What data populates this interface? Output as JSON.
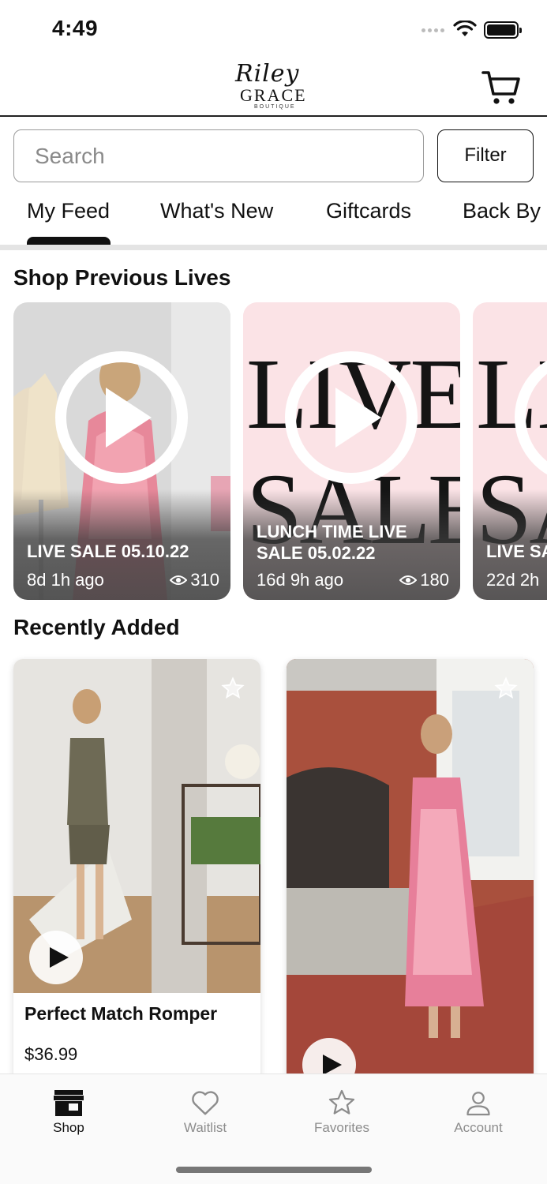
{
  "status_bar": {
    "time": "4:49"
  },
  "header": {
    "logo_script": "Riley",
    "logo_main": "GRACE",
    "logo_sub": "BOUTIQUE",
    "cart_icon": "cart-icon"
  },
  "search": {
    "placeholder": "Search",
    "filter_label": "Filter"
  },
  "tabs": [
    {
      "label": "My Feed",
      "active": true
    },
    {
      "label": "What's New",
      "active": false
    },
    {
      "label": "Giftcards",
      "active": false
    },
    {
      "label": "Back By I",
      "active": false
    }
  ],
  "lives": {
    "title": "Shop Previous Lives",
    "items": [
      {
        "title": "LIVE SALE 05.10.22",
        "ago": "8d 1h ago",
        "views": "310"
      },
      {
        "title": "LUNCH TIME LIVE SALE 05.02.22",
        "ago": "16d 9h ago",
        "views": "180",
        "art_line1": "LIVE",
        "art_line2": "SALE"
      },
      {
        "title": "LIVE SA",
        "ago": "22d 2h",
        "views": "",
        "art_line1": "LI",
        "art_line2": "SA"
      }
    ]
  },
  "recent": {
    "title": "Recently Added",
    "items": [
      {
        "name": "Perfect Match Romper",
        "price": "$36.99",
        "has_video": true
      },
      {
        "name": "",
        "price": "",
        "has_video": true
      }
    ]
  },
  "nav": [
    {
      "label": "Shop",
      "icon": "storefront-icon",
      "active": true
    },
    {
      "label": "Waitlist",
      "icon": "heart-icon",
      "active": false
    },
    {
      "label": "Favorites",
      "icon": "star-icon",
      "active": false
    },
    {
      "label": "Account",
      "icon": "person-icon",
      "active": false
    }
  ],
  "colors": {
    "accent": "#111111",
    "sale_pink": "#fbe3e6",
    "inactive_nav": "#8c8c8c"
  }
}
